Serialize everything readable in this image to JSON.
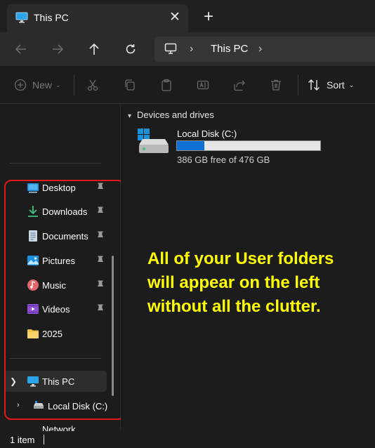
{
  "tab": {
    "title": "This PC",
    "close_glyph": "✕",
    "new_tab_glyph": "+"
  },
  "address": {
    "location": "This PC",
    "sep1": "›",
    "sep2": "›"
  },
  "commands": {
    "new_label": "New",
    "sort_label": "Sort"
  },
  "sidebar": {
    "items": [
      {
        "label": "Desktop",
        "icon": "desktop-folder-icon",
        "pinned": true
      },
      {
        "label": "Downloads",
        "icon": "downloads-icon",
        "pinned": true
      },
      {
        "label": "Documents",
        "icon": "documents-icon",
        "pinned": true
      },
      {
        "label": "Pictures",
        "icon": "pictures-icon",
        "pinned": true
      },
      {
        "label": "Music",
        "icon": "music-icon",
        "pinned": true
      },
      {
        "label": "Videos",
        "icon": "videos-icon",
        "pinned": true
      },
      {
        "label": "2025",
        "icon": "folder-icon",
        "pinned": false
      }
    ],
    "this_pc": "This PC",
    "local_disk": "Local Disk (C:)",
    "network": "Network"
  },
  "main": {
    "group_title": "Devices and drives",
    "drive": {
      "name": "Local Disk (C:)",
      "free_text": "386 GB free of 476 GB",
      "used_fraction": 0.19
    }
  },
  "annotation": {
    "line1": "All of your User folders",
    "line2": "will appear on the left",
    "line3": "without all the clutter."
  },
  "status": {
    "text": "1 item"
  },
  "colors": {
    "accent": "#0f6fd3",
    "highlight": "#e01a1a",
    "annotation": "#ffff00"
  }
}
